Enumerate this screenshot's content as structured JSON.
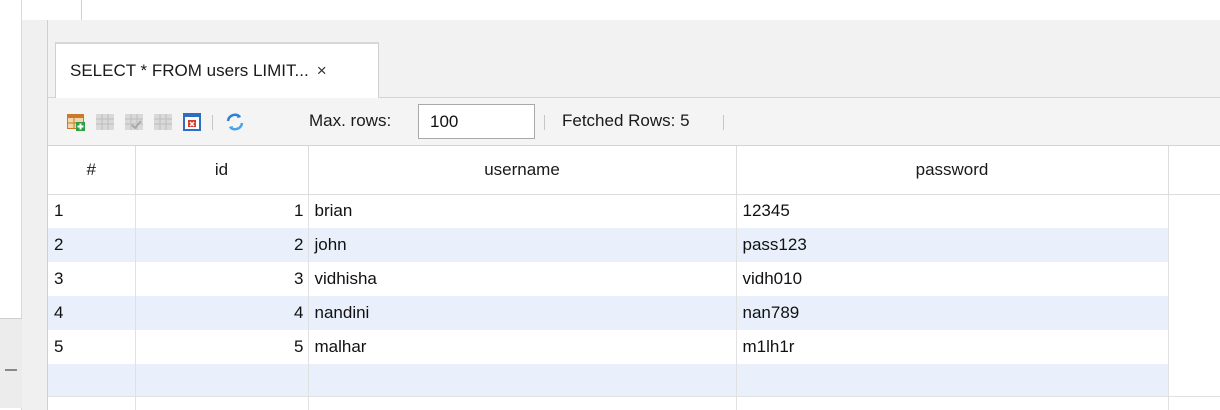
{
  "tab": {
    "label": "SELECT * FROM users LIMIT...",
    "close": "×"
  },
  "toolbar": {
    "icons": [
      "add-row-icon",
      "grid-icon",
      "grid-check-icon",
      "grid-plain-icon",
      "export-icon",
      "refresh-icon"
    ],
    "max_rows_label": "Max. rows:",
    "max_rows_value": "100",
    "fetched_rows": "Fetched Rows: 5"
  },
  "grid": {
    "columns": [
      "#",
      "id",
      "username",
      "password"
    ],
    "rows": [
      {
        "num": "1",
        "id": "1",
        "username": "brian",
        "password": "12345"
      },
      {
        "num": "2",
        "id": "2",
        "username": "john",
        "password": "pass123"
      },
      {
        "num": "3",
        "id": "3",
        "username": "vidhisha",
        "password": "vidh010"
      },
      {
        "num": "4",
        "id": "4",
        "username": "nandini",
        "password": "nan789"
      },
      {
        "num": "5",
        "id": "5",
        "username": "malhar",
        "password": "m1lh1r"
      }
    ]
  },
  "colors": {
    "alt_row": "#e9f0fb",
    "accent": "#1e6fd0"
  }
}
